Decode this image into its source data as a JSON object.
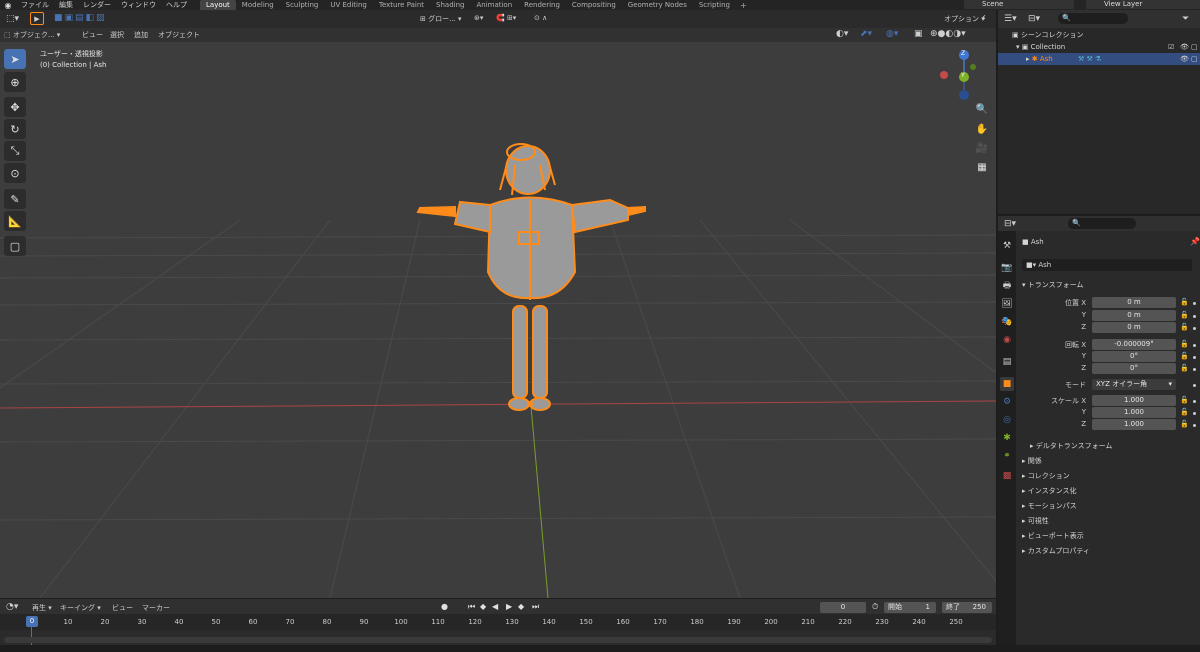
{
  "topbar": {
    "menus": [
      "ファイル",
      "編集",
      "レンダー",
      "ウィンドウ",
      "ヘルプ"
    ],
    "workspaces": [
      "Layout",
      "Modeling",
      "Sculpting",
      "UV Editing",
      "Texture Paint",
      "Shading",
      "Animation",
      "Rendering",
      "Compositing",
      "Geometry Nodes",
      "Scripting"
    ],
    "active_workspace": "Layout",
    "scene": "Scene",
    "view_layer": "View Layer"
  },
  "viewport": {
    "mode": "オブジェク...",
    "menus": [
      "ビュー",
      "選択",
      "追加",
      "オブジェクト"
    ],
    "transform_orientation": "グロー...",
    "options": "オプション",
    "overlay_title": "ユーザー・透視投影",
    "overlay_subtitle": "(0) Collection | Ash",
    "gizmo": {
      "z": "Z",
      "y": "Y"
    }
  },
  "outliner": {
    "scene_collection": "シーンコレクション",
    "collection": "Collection",
    "object": "Ash"
  },
  "properties": {
    "object_name": "Ash",
    "data_name": "Ash",
    "transform_title": "トランスフォーム",
    "location_label": "位置",
    "rotation_label": "回転",
    "mode_label": "モード",
    "scale_label": "スケール",
    "axis_x": "X",
    "axis_y": "Y",
    "axis_z": "Z",
    "location": [
      "0 m",
      "0 m",
      "0 m"
    ],
    "rotation": [
      "-0.000009°",
      "0°",
      "0°"
    ],
    "rotation_mode": "XYZ オイラー角",
    "scale": [
      "1.000",
      "1.000",
      "1.000"
    ],
    "delta_transform": "デルタトランスフォーム",
    "sections": [
      "関係",
      "コレクション",
      "インスタンス化",
      "モーションパス",
      "可視性",
      "ビューポート表示",
      "カスタムプロパティ"
    ]
  },
  "timeline": {
    "playback": "再生",
    "keying": "キーイング",
    "view": "ビュー",
    "marker": "マーカー",
    "current_frame": "0",
    "start_label": "開始",
    "start": "1",
    "end_label": "終了",
    "end": "250",
    "playhead": "0",
    "ticks": [
      "10",
      "20",
      "30",
      "40",
      "50",
      "60",
      "70",
      "80",
      "90",
      "100",
      "110",
      "120",
      "130",
      "140",
      "150",
      "160",
      "170",
      "180",
      "190",
      "200",
      "210",
      "220",
      "230",
      "240",
      "250"
    ]
  },
  "colors": {
    "selected_outline": "#ff8c1a",
    "active_blue": "#4772b3",
    "x_axis": "#c44a4a",
    "y_axis": "#7fb02a"
  }
}
